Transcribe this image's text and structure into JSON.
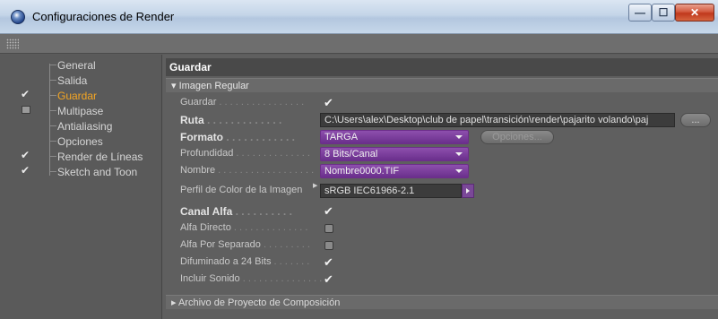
{
  "window": {
    "title": "Configuraciones de Render",
    "min_glyph": "—",
    "max_glyph": "☐",
    "close_glyph": "✕"
  },
  "sidebar": {
    "items": [
      {
        "label": "General",
        "checked": null,
        "active": false
      },
      {
        "label": "Salida",
        "checked": null,
        "active": false
      },
      {
        "label": "Guardar",
        "checked": true,
        "active": true
      },
      {
        "label": "Multipase",
        "checked": false,
        "active": false
      },
      {
        "label": "Antialiasing",
        "checked": null,
        "active": false
      },
      {
        "label": "Opciones",
        "checked": null,
        "active": false
      },
      {
        "label": "Render de Líneas",
        "checked": true,
        "active": false
      },
      {
        "label": "Sketch and Toon",
        "checked": true,
        "active": false
      }
    ]
  },
  "main": {
    "panel_title": "Guardar",
    "group_title": "▾ Imagen Regular",
    "rows": {
      "guardar": {
        "label": "Guardar",
        "dots": " . . . . . . . . . . . . . . . .",
        "checked": true
      },
      "ruta": {
        "label": "Ruta",
        "dots": " . . . . . . . . . . . . .",
        "value": "C:\\Users\\alex\\Desktop\\club de papel\\transición\\render\\pajarito volando\\paj",
        "browse": "..."
      },
      "formato": {
        "label": "Formato",
        "dots": " . . . . . . . . . . . .",
        "value": "TARGA",
        "options_button": "Opciones..."
      },
      "profundidad": {
        "label": "Profundidad",
        "dots": " . . . . . . . . . . . . . .",
        "value": "8 Bits/Canal"
      },
      "nombre": {
        "label": "Nombre",
        "dots": " . . . . . . . . . . . . . . . . . .",
        "value": "Nombre0000.TIF"
      },
      "perfil": {
        "label": "Perfil de Color de la Imagen",
        "value": "sRGB IEC61966-2.1"
      },
      "canal_alfa": {
        "label": "Canal Alfa",
        "dots": " . . . . . . . . . .",
        "checked": true
      },
      "alfa_directo": {
        "label": "Alfa Directo",
        "dots": " . . . . . . . . . . . . . .",
        "checked": false
      },
      "alfa_separado": {
        "label": "Alfa Por Separado",
        "dots": " . . . . . . . . .",
        "checked": false
      },
      "difuminado": {
        "label": "Difuminado a 24 Bits",
        "dots": " . . . . . . .",
        "checked": true
      },
      "sonido": {
        "label": "Incluir Sonido",
        "dots": " . . . . . . . . . . . . . . .",
        "checked": true
      }
    },
    "footer_group": "▸ Archivo de Proyecto de Composición"
  },
  "colors": {
    "active_item": "#f5a623",
    "dropdown": "#7a3e9c",
    "panel_bg": "#5f5f5f"
  }
}
